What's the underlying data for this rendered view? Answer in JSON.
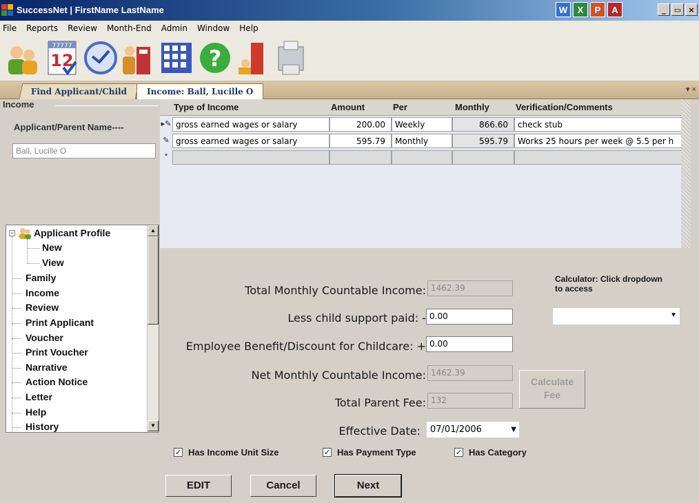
{
  "window": {
    "title": "SuccessNet  |  FirstName LastName",
    "title_icons": [
      "W",
      "X",
      "P",
      "A"
    ],
    "minimize": "_",
    "restore": "▭",
    "close": "×"
  },
  "menu": [
    "File",
    "Reports",
    "Review",
    "Month-End",
    "Admin",
    "Window",
    "Help"
  ],
  "toolbar": {
    "tools": [
      "people-icon",
      "calendar-icon",
      "clock-icon",
      "folder-icon",
      "grid-icon",
      "help-icon",
      "exit-icon",
      "printer-icon"
    ],
    "calendar_top": "77777",
    "calendar_day": "12"
  },
  "tabs": {
    "find": "Find Applicant/Child",
    "income": "Income: Ball, Lucille O",
    "pin": "▾ ×"
  },
  "left": {
    "legend": "Income",
    "parent_label": "Applicant/Parent Name----",
    "parent_value": "Ball, Lucille O"
  },
  "tree": {
    "root": "Applicant Profile",
    "children": [
      "New",
      "View"
    ],
    "items": [
      "Family",
      "Income",
      "Review",
      "Print Applicant",
      "Voucher",
      "Print Voucher",
      "Narrative",
      "Action Notice",
      "Letter",
      "Help",
      "History"
    ]
  },
  "grid": {
    "headers": [
      "Type of Income",
      "Amount",
      "Per",
      "Monthly",
      "Verification/Comments"
    ],
    "rows": [
      {
        "type": "gross earned wages or salary",
        "amount": "200.00",
        "per": "Weekly",
        "monthly": "866.60",
        "comments": "check stub"
      },
      {
        "type": "gross earned wages or salary",
        "amount": "595.79",
        "per": "Monthly",
        "monthly": "595.79",
        "comments": "Works 25 hours per week @ 5.5 per h"
      }
    ],
    "new_row_marker": "*"
  },
  "form": {
    "total_label": "Total Monthly Countable Income:",
    "total_value": "1462.39",
    "less_label": "Less child support paid:  -",
    "less_value": "0.00",
    "benefit_label": "Employee Benefit/Discount for Childcare:  +",
    "benefit_value": "0.00",
    "net_label": "Net Monthly Countable Income:",
    "net_value": "1462.39",
    "fee_label": "Total Parent Fee:",
    "fee_value": "132",
    "date_label": "Effective Date:",
    "date_value": "07/01/2006",
    "calc_note": "Calculator: Click dropdown to access",
    "calc_btn_line1": "Calculate",
    "calc_btn_line2": "Fee",
    "calc_select_value": "",
    "checkboxes": [
      {
        "label": "Has Income Unit Size",
        "checked": true
      },
      {
        "label": "Has Payment Type",
        "checked": true
      },
      {
        "label": "Has Category",
        "checked": true
      }
    ],
    "buttons": {
      "edit": "EDIT",
      "cancel": "Cancel",
      "next": "Next"
    }
  },
  "colors": {
    "title_bar": "#0a246a",
    "tab_bar": "#c9b08b",
    "form_bg": "#d4d0c8",
    "grid_bg": "#e6e8f2"
  }
}
